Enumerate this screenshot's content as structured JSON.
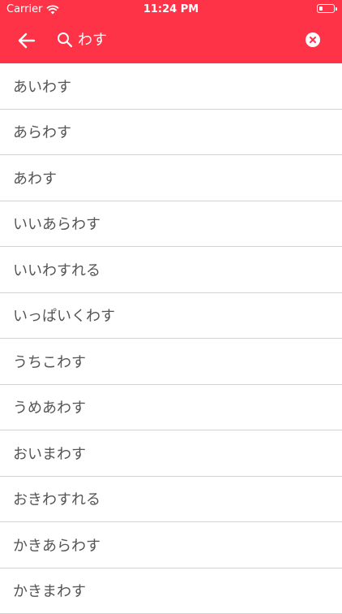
{
  "status_bar": {
    "carrier": "Carrier",
    "time": "11:24 PM"
  },
  "search": {
    "query": "わす"
  },
  "results": [
    "あいわす",
    "あらわす",
    "あわす",
    "いいあらわす",
    "いいわすれる",
    "いっぱいくわす",
    "うちこわす",
    "うめあわす",
    "おいまわす",
    "おきわすれる",
    "かきあらわす",
    "かきまわす"
  ],
  "colors": {
    "header": "#ff3347",
    "text": "#555555",
    "divider": "#d2d2d2"
  },
  "icons": [
    "wifi-icon",
    "battery-icon",
    "back-arrow-icon",
    "search-icon",
    "clear-icon"
  ]
}
